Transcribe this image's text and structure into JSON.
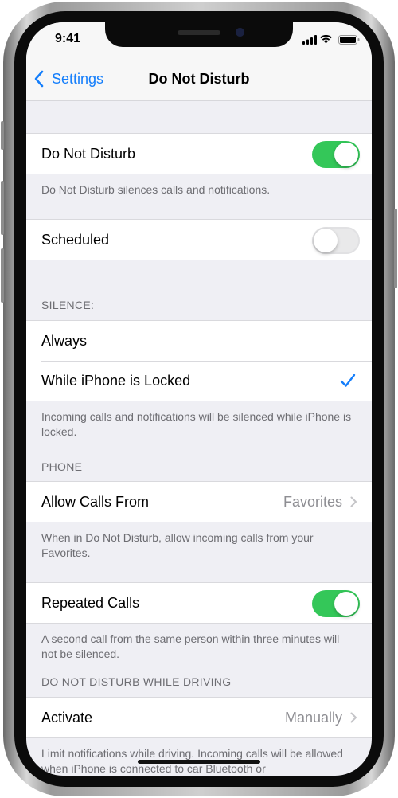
{
  "status_bar": {
    "time": "9:41"
  },
  "nav": {
    "back_label": "Settings",
    "title": "Do Not Disturb"
  },
  "settings": {
    "dnd_label": "Do Not Disturb",
    "dnd_on": true,
    "dnd_footer": "Do Not Disturb silences calls and notifications.",
    "scheduled_label": "Scheduled",
    "scheduled_on": false,
    "silence_header": "SILENCE:",
    "always_label": "Always",
    "while_locked_label": "While iPhone is Locked",
    "silence_footer": "Incoming calls and notifications will be silenced while iPhone is locked.",
    "phone_header": "PHONE",
    "allow_calls_label": "Allow Calls From",
    "allow_calls_value": "Favorites",
    "allow_calls_footer": "When in Do Not Disturb, allow incoming calls from your Favorites.",
    "repeated_calls_label": "Repeated Calls",
    "repeated_calls_on": true,
    "repeated_calls_footer": "A second call from the same person within three minutes will not be silenced.",
    "driving_header": "DO NOT DISTURB WHILE DRIVING",
    "activate_label": "Activate",
    "activate_value": "Manually",
    "driving_footer": "Limit notifications while driving. Incoming calls will be allowed when iPhone is connected to car Bluetooth or"
  },
  "colors": {
    "accent": "#147efb",
    "switch_on": "#34c759",
    "background": "#efeff4"
  }
}
